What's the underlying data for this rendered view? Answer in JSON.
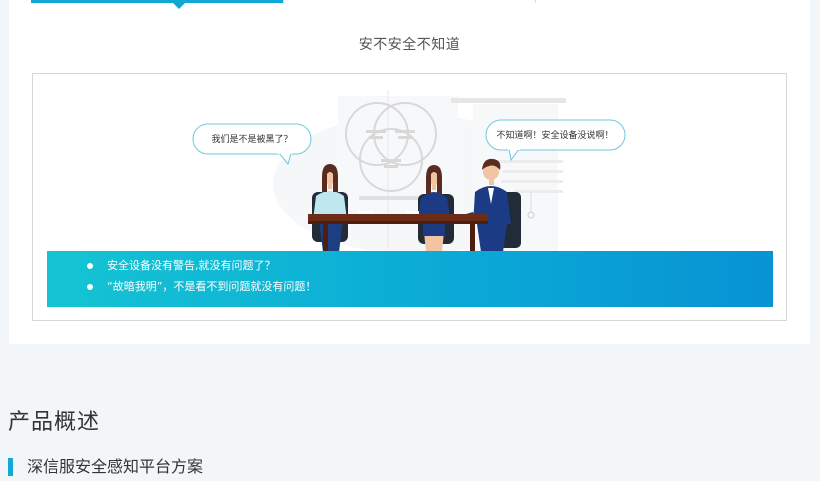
{
  "section": {
    "title": "安不安全不知道",
    "bubbles": {
      "left": "我们是不是被黑了？",
      "right": "不知道啊！安全设备没说啊！"
    },
    "points": [
      "安全设备没有警告,就没有问题了？",
      "“故暗我明”，不是看不到问题就没有问题！"
    ]
  },
  "overview": {
    "heading": "产品概述",
    "sub_heading": "深信服安全感知平台方案"
  },
  "colors": {
    "accent": "#10a9d6",
    "band_start": "#14c4d3",
    "band_end": "#0893d3"
  }
}
